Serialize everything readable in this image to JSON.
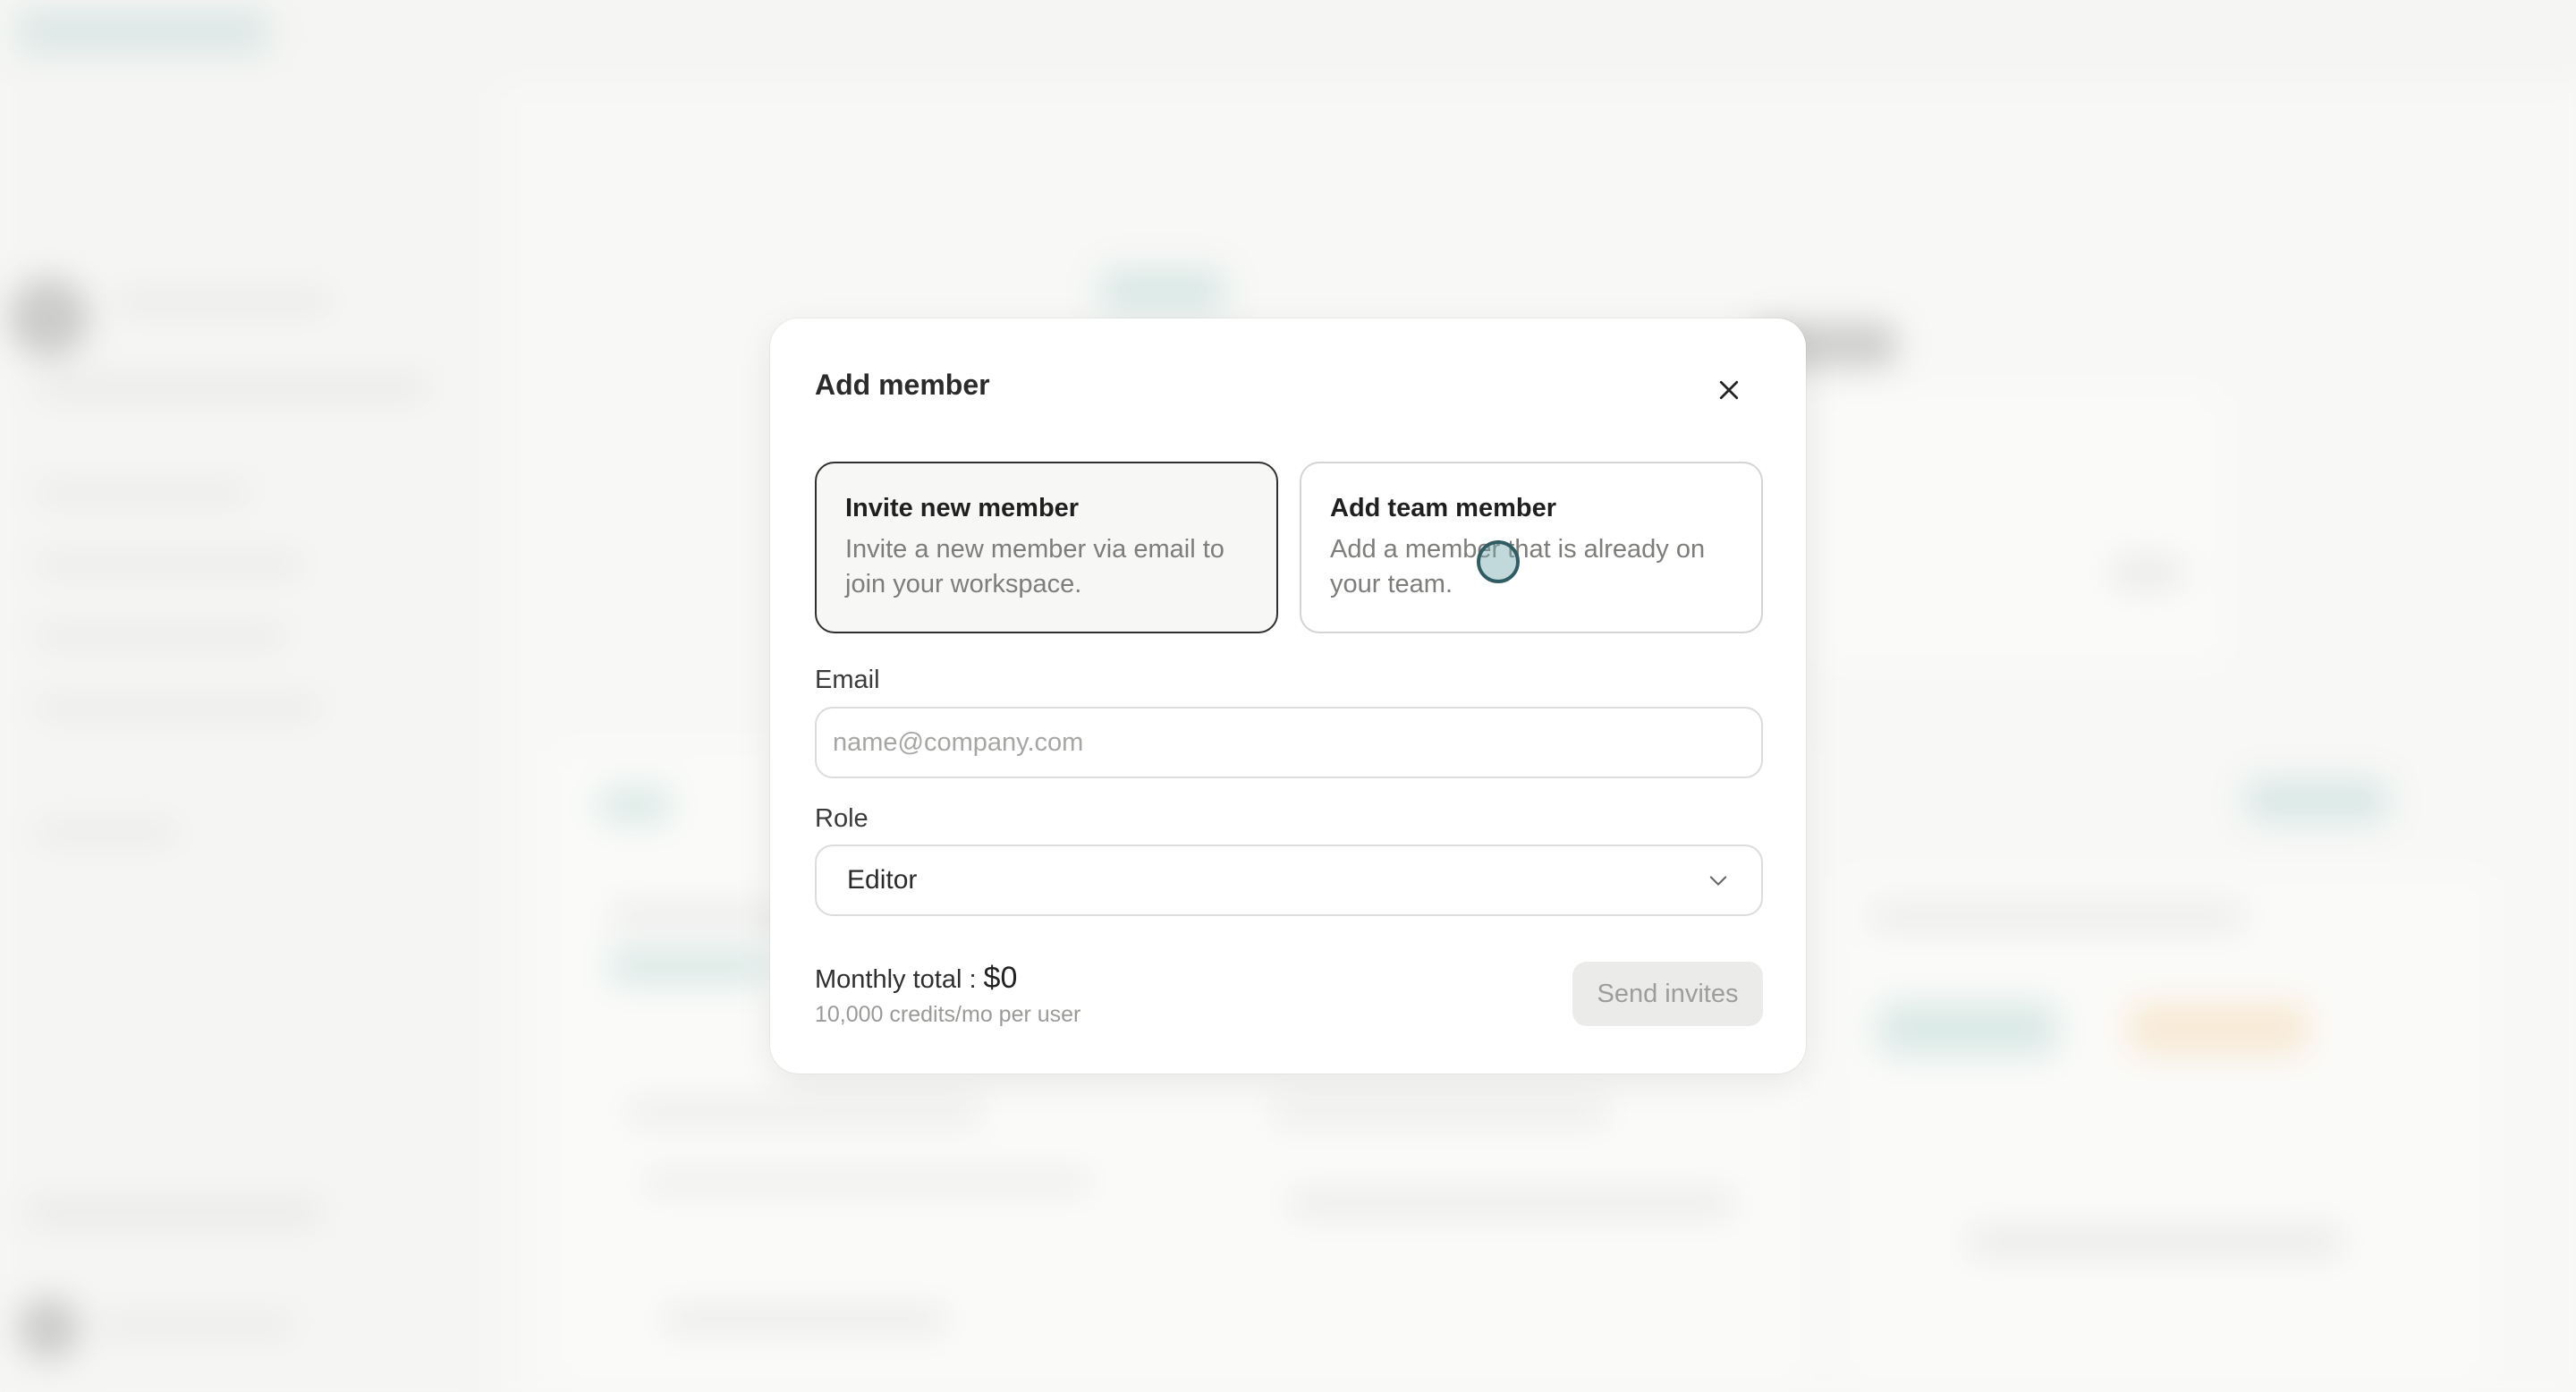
{
  "modal": {
    "title": "Add member",
    "options": [
      {
        "title": "Invite new member",
        "description": "Invite a new member via email to join your workspace.",
        "selected": true
      },
      {
        "title": "Add team member",
        "description": "Add a member that is already on your team.",
        "selected": false
      }
    ],
    "email": {
      "label": "Email",
      "placeholder": "name@company.com",
      "value": ""
    },
    "role": {
      "label": "Role",
      "value": "Editor"
    },
    "total": {
      "label": "Monthly total :",
      "amount": "$0",
      "subtext": "10,000 credits/mo per user"
    },
    "send_button": {
      "label": "Send invites",
      "disabled": true
    }
  },
  "icons": {
    "close": "close-icon",
    "chevron": "chevron-down-icon"
  },
  "colors": {
    "selected_border": "#2f2f2f",
    "cursor_ring": "#2f5d63",
    "disabled_button_bg": "#ebebea"
  }
}
